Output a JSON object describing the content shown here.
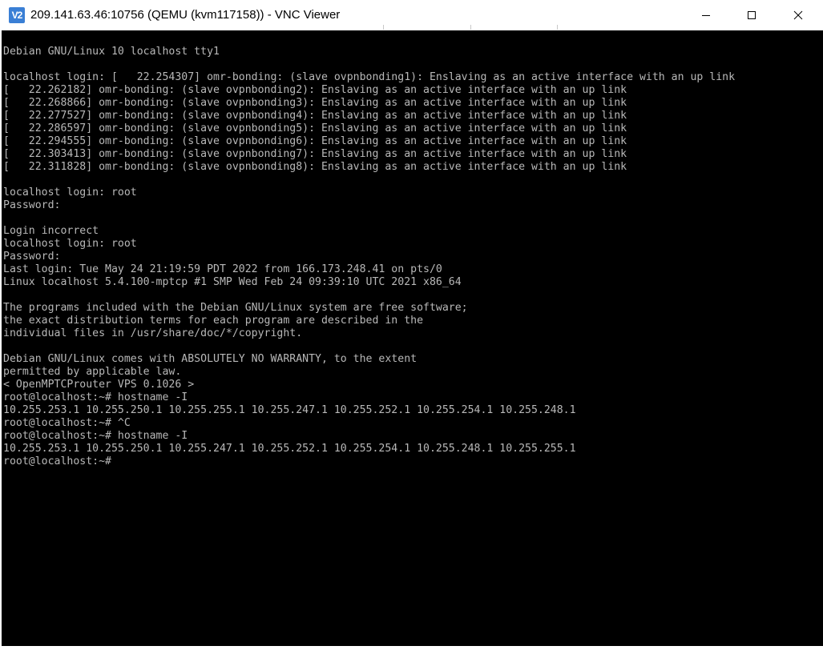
{
  "window": {
    "title": "209.141.63.46:10756 (QEMU (kvm117158)) - VNC Viewer",
    "icon_text": "V2",
    "controls": {
      "minimize": "minimize-icon",
      "maximize": "maximize-icon",
      "close": "close-icon"
    }
  },
  "terminal": {
    "background": "#000000",
    "foreground": "#b8b8b8",
    "lines": [
      "Debian GNU/Linux 10 localhost tty1",
      "",
      "localhost login: [   22.254307] omr-bonding: (slave ovpnbonding1): Enslaving as an active interface with an up link",
      "[   22.262182] omr-bonding: (slave ovpnbonding2): Enslaving as an active interface with an up link",
      "[   22.268866] omr-bonding: (slave ovpnbonding3): Enslaving as an active interface with an up link",
      "[   22.277527] omr-bonding: (slave ovpnbonding4): Enslaving as an active interface with an up link",
      "[   22.286597] omr-bonding: (slave ovpnbonding5): Enslaving as an active interface with an up link",
      "[   22.294555] omr-bonding: (slave ovpnbonding6): Enslaving as an active interface with an up link",
      "[   22.303413] omr-bonding: (slave ovpnbonding7): Enslaving as an active interface with an up link",
      "[   22.311828] omr-bonding: (slave ovpnbonding8): Enslaving as an active interface with an up link",
      "",
      "localhost login: root",
      "Password:",
      "",
      "Login incorrect",
      "localhost login: root",
      "Password:",
      "Last login: Tue May 24 21:19:59 PDT 2022 from 166.173.248.41 on pts/0",
      "Linux localhost 5.4.100-mptcp #1 SMP Wed Feb 24 09:39:10 UTC 2021 x86_64",
      "",
      "The programs included with the Debian GNU/Linux system are free software;",
      "the exact distribution terms for each program are described in the",
      "individual files in /usr/share/doc/*/copyright.",
      "",
      "Debian GNU/Linux comes with ABSOLUTELY NO WARRANTY, to the extent",
      "permitted by applicable law.",
      "< OpenMPTCProuter VPS 0.1026 >",
      "root@localhost:~# hostname -I",
      "10.255.253.1 10.255.250.1 10.255.255.1 10.255.247.1 10.255.252.1 10.255.254.1 10.255.248.1",
      "root@localhost:~# ^C",
      "root@localhost:~# hostname -I",
      "10.255.253.1 10.255.250.1 10.255.247.1 10.255.252.1 10.255.254.1 10.255.248.1 10.255.255.1",
      "root@localhost:~#"
    ]
  }
}
